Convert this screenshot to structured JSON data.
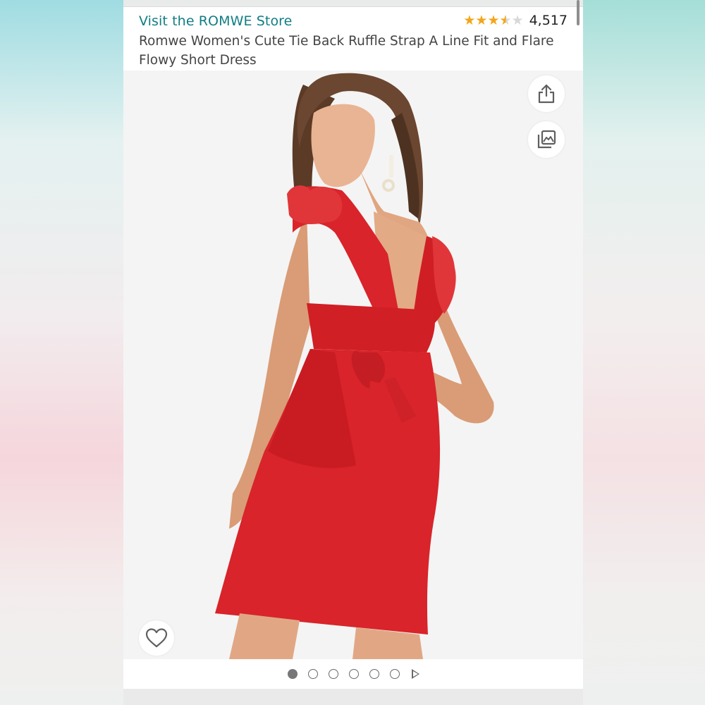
{
  "store": {
    "link_text": "Visit the ROMWE Store"
  },
  "rating": {
    "stars": 3.5,
    "count": "4,517",
    "star_color": "#f3a619"
  },
  "product": {
    "title": "Romwe Women's Cute Tie Back Ruffle Strap A Line Fit and Flare Flowy Short Dress"
  },
  "gallery": {
    "image_subject": "red-ruffle-tie-back-dress",
    "total_images": 6,
    "active_index": 0,
    "has_video": true,
    "icons": {
      "share": "share-icon",
      "view_images": "images-icon",
      "favorite": "heart-icon"
    }
  },
  "colors": {
    "link": "#117d85",
    "dress": "#d8242a"
  }
}
